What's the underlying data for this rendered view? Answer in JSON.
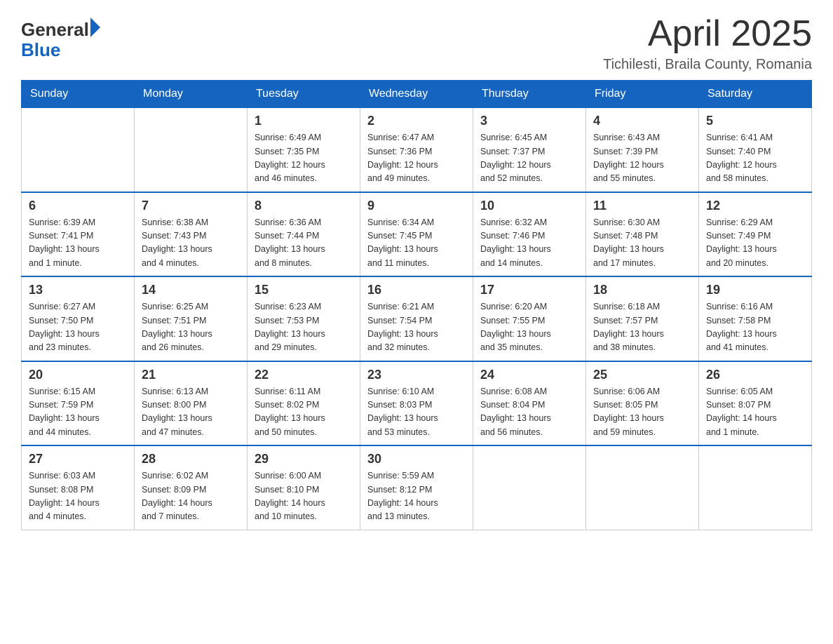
{
  "header": {
    "logo": {
      "general": "General",
      "blue": "Blue"
    },
    "title": "April 2025",
    "location": "Tichilesti, Braila County, Romania"
  },
  "weekdays": [
    "Sunday",
    "Monday",
    "Tuesday",
    "Wednesday",
    "Thursday",
    "Friday",
    "Saturday"
  ],
  "weeks": [
    [
      {
        "day": "",
        "info": []
      },
      {
        "day": "",
        "info": []
      },
      {
        "day": "1",
        "info": [
          "Sunrise: 6:49 AM",
          "Sunset: 7:35 PM",
          "Daylight: 12 hours",
          "and 46 minutes."
        ]
      },
      {
        "day": "2",
        "info": [
          "Sunrise: 6:47 AM",
          "Sunset: 7:36 PM",
          "Daylight: 12 hours",
          "and 49 minutes."
        ]
      },
      {
        "day": "3",
        "info": [
          "Sunrise: 6:45 AM",
          "Sunset: 7:37 PM",
          "Daylight: 12 hours",
          "and 52 minutes."
        ]
      },
      {
        "day": "4",
        "info": [
          "Sunrise: 6:43 AM",
          "Sunset: 7:39 PM",
          "Daylight: 12 hours",
          "and 55 minutes."
        ]
      },
      {
        "day": "5",
        "info": [
          "Sunrise: 6:41 AM",
          "Sunset: 7:40 PM",
          "Daylight: 12 hours",
          "and 58 minutes."
        ]
      }
    ],
    [
      {
        "day": "6",
        "info": [
          "Sunrise: 6:39 AM",
          "Sunset: 7:41 PM",
          "Daylight: 13 hours",
          "and 1 minute."
        ]
      },
      {
        "day": "7",
        "info": [
          "Sunrise: 6:38 AM",
          "Sunset: 7:43 PM",
          "Daylight: 13 hours",
          "and 4 minutes."
        ]
      },
      {
        "day": "8",
        "info": [
          "Sunrise: 6:36 AM",
          "Sunset: 7:44 PM",
          "Daylight: 13 hours",
          "and 8 minutes."
        ]
      },
      {
        "day": "9",
        "info": [
          "Sunrise: 6:34 AM",
          "Sunset: 7:45 PM",
          "Daylight: 13 hours",
          "and 11 minutes."
        ]
      },
      {
        "day": "10",
        "info": [
          "Sunrise: 6:32 AM",
          "Sunset: 7:46 PM",
          "Daylight: 13 hours",
          "and 14 minutes."
        ]
      },
      {
        "day": "11",
        "info": [
          "Sunrise: 6:30 AM",
          "Sunset: 7:48 PM",
          "Daylight: 13 hours",
          "and 17 minutes."
        ]
      },
      {
        "day": "12",
        "info": [
          "Sunrise: 6:29 AM",
          "Sunset: 7:49 PM",
          "Daylight: 13 hours",
          "and 20 minutes."
        ]
      }
    ],
    [
      {
        "day": "13",
        "info": [
          "Sunrise: 6:27 AM",
          "Sunset: 7:50 PM",
          "Daylight: 13 hours",
          "and 23 minutes."
        ]
      },
      {
        "day": "14",
        "info": [
          "Sunrise: 6:25 AM",
          "Sunset: 7:51 PM",
          "Daylight: 13 hours",
          "and 26 minutes."
        ]
      },
      {
        "day": "15",
        "info": [
          "Sunrise: 6:23 AM",
          "Sunset: 7:53 PM",
          "Daylight: 13 hours",
          "and 29 minutes."
        ]
      },
      {
        "day": "16",
        "info": [
          "Sunrise: 6:21 AM",
          "Sunset: 7:54 PM",
          "Daylight: 13 hours",
          "and 32 minutes."
        ]
      },
      {
        "day": "17",
        "info": [
          "Sunrise: 6:20 AM",
          "Sunset: 7:55 PM",
          "Daylight: 13 hours",
          "and 35 minutes."
        ]
      },
      {
        "day": "18",
        "info": [
          "Sunrise: 6:18 AM",
          "Sunset: 7:57 PM",
          "Daylight: 13 hours",
          "and 38 minutes."
        ]
      },
      {
        "day": "19",
        "info": [
          "Sunrise: 6:16 AM",
          "Sunset: 7:58 PM",
          "Daylight: 13 hours",
          "and 41 minutes."
        ]
      }
    ],
    [
      {
        "day": "20",
        "info": [
          "Sunrise: 6:15 AM",
          "Sunset: 7:59 PM",
          "Daylight: 13 hours",
          "and 44 minutes."
        ]
      },
      {
        "day": "21",
        "info": [
          "Sunrise: 6:13 AM",
          "Sunset: 8:00 PM",
          "Daylight: 13 hours",
          "and 47 minutes."
        ]
      },
      {
        "day": "22",
        "info": [
          "Sunrise: 6:11 AM",
          "Sunset: 8:02 PM",
          "Daylight: 13 hours",
          "and 50 minutes."
        ]
      },
      {
        "day": "23",
        "info": [
          "Sunrise: 6:10 AM",
          "Sunset: 8:03 PM",
          "Daylight: 13 hours",
          "and 53 minutes."
        ]
      },
      {
        "day": "24",
        "info": [
          "Sunrise: 6:08 AM",
          "Sunset: 8:04 PM",
          "Daylight: 13 hours",
          "and 56 minutes."
        ]
      },
      {
        "day": "25",
        "info": [
          "Sunrise: 6:06 AM",
          "Sunset: 8:05 PM",
          "Daylight: 13 hours",
          "and 59 minutes."
        ]
      },
      {
        "day": "26",
        "info": [
          "Sunrise: 6:05 AM",
          "Sunset: 8:07 PM",
          "Daylight: 14 hours",
          "and 1 minute."
        ]
      }
    ],
    [
      {
        "day": "27",
        "info": [
          "Sunrise: 6:03 AM",
          "Sunset: 8:08 PM",
          "Daylight: 14 hours",
          "and 4 minutes."
        ]
      },
      {
        "day": "28",
        "info": [
          "Sunrise: 6:02 AM",
          "Sunset: 8:09 PM",
          "Daylight: 14 hours",
          "and 7 minutes."
        ]
      },
      {
        "day": "29",
        "info": [
          "Sunrise: 6:00 AM",
          "Sunset: 8:10 PM",
          "Daylight: 14 hours",
          "and 10 minutes."
        ]
      },
      {
        "day": "30",
        "info": [
          "Sunrise: 5:59 AM",
          "Sunset: 8:12 PM",
          "Daylight: 14 hours",
          "and 13 minutes."
        ]
      },
      {
        "day": "",
        "info": []
      },
      {
        "day": "",
        "info": []
      },
      {
        "day": "",
        "info": []
      }
    ]
  ]
}
